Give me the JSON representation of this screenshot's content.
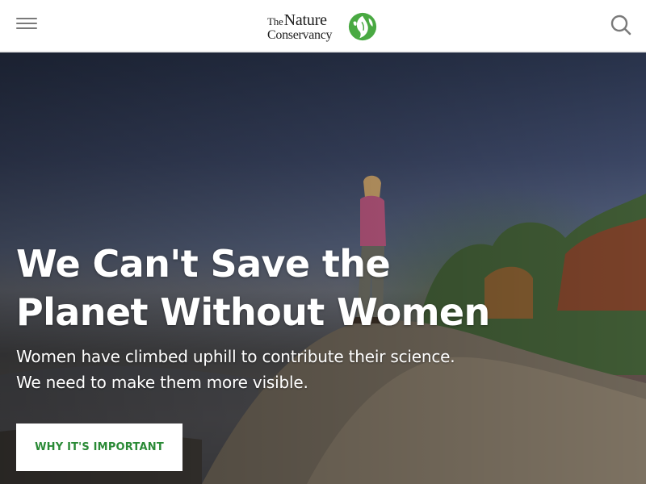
{
  "header": {
    "menu_icon": "hamburger-menu-icon",
    "logo": {
      "line1_prefix": "The",
      "line1_main": "Nature",
      "line2": "Conservancy",
      "icon": "leaf-globe-icon"
    },
    "search_icon": "search-icon"
  },
  "hero": {
    "title": "We Can't Save the Planet Without Women",
    "subtitle": "Women have climbed uphill to contribute their science. We need to make them more visible.",
    "cta_label": "WHY IT'S IMPORTANT"
  },
  "colors": {
    "brand_green": "#49a942",
    "cta_text": "#2a8a36",
    "header_bg": "#ffffff",
    "icon_gray": "#7a7a7a"
  }
}
